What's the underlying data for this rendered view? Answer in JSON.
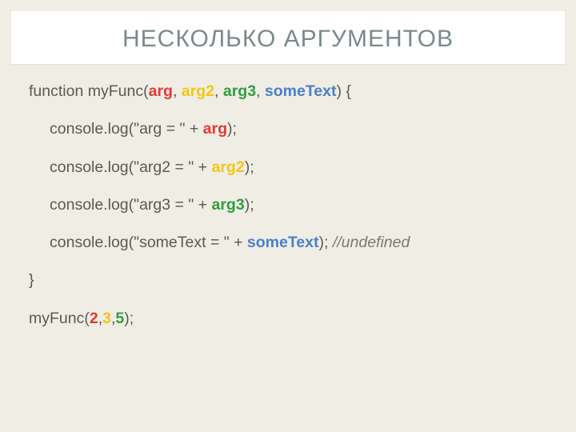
{
  "title": "НЕСКОЛЬКО АРГУМЕНТОВ",
  "code": {
    "kw_function": "function",
    "func_name": "myFunc",
    "params": {
      "p1": "arg",
      "p2": "arg2",
      "p3": "arg3",
      "p4": "someText"
    },
    "brace_open": "{",
    "brace_close": "}",
    "comma": ", ",
    "comma_tight": ",",
    "paren_open": "(",
    "paren_close_brace": ") {",
    "paren_close_semi": ");",
    "console_log": "console.log(",
    "str_arg": "\"arg = \"",
    "str_arg2": "\"arg2 = \"",
    "str_arg3": "\"arg3 = \"",
    "str_some": "\"someText = \"",
    "plus": " + ",
    "comment_undef": "//undefined",
    "call_name": "myFunc(",
    "call_args": {
      "a1": "2",
      "a2": "3",
      "a3": "5"
    }
  }
}
